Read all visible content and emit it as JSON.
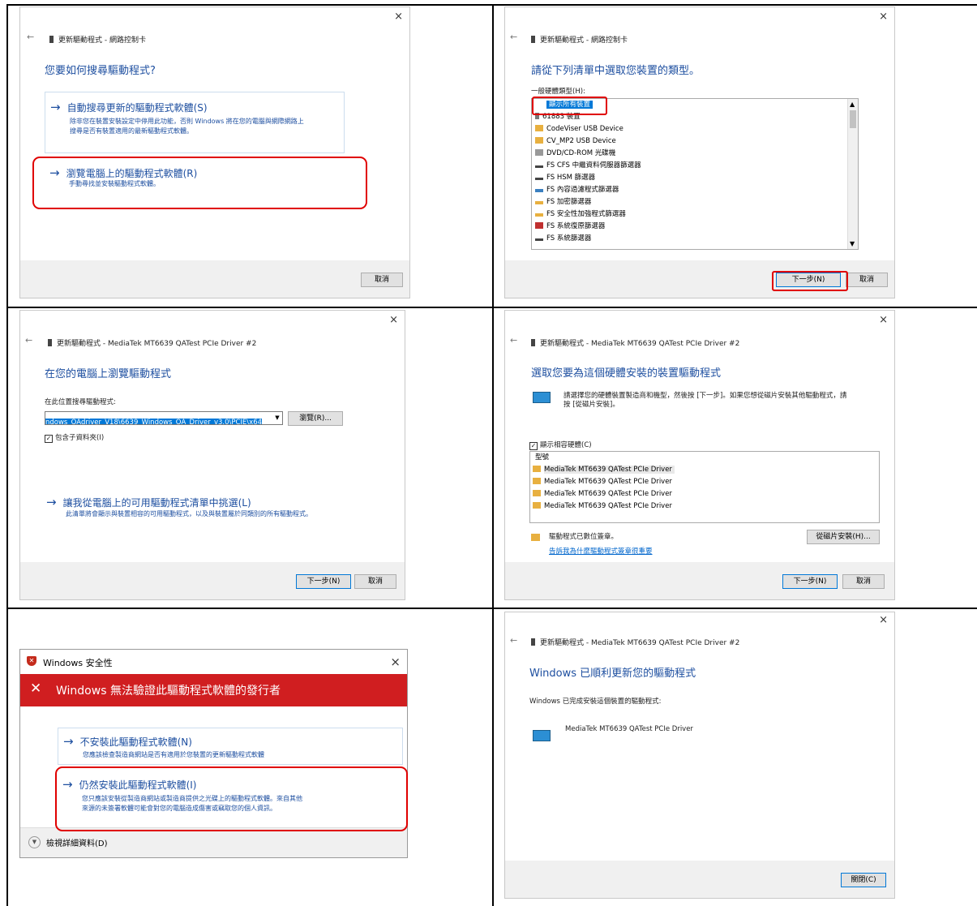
{
  "panel1": {
    "close": "×",
    "back": "←",
    "header": "更新驅動程式 - 網路控制卡",
    "heading": "您要如何搜尋驅動程式?",
    "option_auto_title": "自動搜尋更新的驅動程式軟體(S)",
    "option_auto_desc1": "除非您在裝置安裝設定中停用此功能，否則 Windows 將在您的電腦與網際網路上",
    "option_auto_desc2": "搜尋是否有裝置適用的最新驅動程式軟體。",
    "option_browse_title": "瀏覽電腦上的驅動程式軟體(R)",
    "option_browse_desc": "手動尋找並安裝驅動程式軟體。",
    "cancel": "取消"
  },
  "panel2": {
    "close": "×",
    "back": "←",
    "header": "更新驅動程式 - 網路控制卡",
    "heading": "請從下列清單中選取您裝置的類型。",
    "list_label": "一般硬體類型(H):",
    "items": [
      "顯示所有裝置",
      "61883 裝置",
      "CodeViser USB Device",
      "CV_MP2 USB Device",
      "DVD/CD-ROM 光碟機",
      "FS CFS 中繼資料伺服器篩選器",
      "FS HSM 篩選器",
      "FS 內容過濾程式篩選器",
      "FS 加密篩選器",
      "FS 安全性加強程式篩選器",
      "FS 系統復原篩選器",
      "FS 系統篩選器"
    ],
    "next": "下一步(N)",
    "cancel": "取消"
  },
  "panel3": {
    "close": "×",
    "back": "←",
    "header": "更新驅動程式 - MediaTek MT6639 QATest PCIe Driver #2",
    "heading": "在您的電腦上瀏覽驅動程式",
    "search_label": "在此位置搜尋驅動程式:",
    "path_value": "ndows_QAdriver_V18\\6639_Windows_QA_Driver_v3.0\\PCIE\\x64",
    "browse": "瀏覽(R)...",
    "include_sub": "包含子資料夾(I)",
    "pick_title": "讓我從電腦上的可用驅動程式清單中挑選(L)",
    "pick_desc": "此清單將會顯示與裝置相容的可用驅動程式，以及與裝置屬於同類別的所有驅動程式。",
    "next": "下一步(N)",
    "cancel": "取消"
  },
  "panel4": {
    "close": "×",
    "back": "←",
    "header": "更新驅動程式 - MediaTek MT6639 QATest PCIe Driver #2",
    "heading": "選取您要為這個硬體安裝的裝置驅動程式",
    "desc1": "請選擇您的硬體裝置製造商和機型，然後按 [下一步]。如果您想從磁片安裝其他驅動程式，請",
    "desc2": "按 [從磁片安裝]。",
    "show_compat": "顯示相容硬體(C)",
    "model_header": "型號",
    "models": [
      "MediaTek MT6639 QATest PCIe Driver",
      "MediaTek MT6639 QATest PCIe Driver",
      "MediaTek MT6639 QATest PCIe Driver",
      "MediaTek MT6639 QATest PCIe Driver"
    ],
    "signed": "驅動程式已數位簽章。",
    "why_link": "告訴我為什麼驅動程式簽章很重要",
    "have_disk": "從磁片安裝(H)...",
    "next": "下一步(N)",
    "cancel": "取消"
  },
  "panel5": {
    "title": "Windows 安全性",
    "close": "×",
    "banner": "Windows 無法驗證此驅動程式軟體的發行者",
    "banner_x": "✕",
    "opt1_title": "不安裝此驅動程式軟體(N)",
    "opt1_desc": "您應該檢查製造商網站是否有適用於您裝置的更新驅動程式軟體",
    "opt2_title": "仍然安裝此驅動程式軟體(I)",
    "opt2_desc1": "您只應該安裝從製造商網站或製造商提供之光碟上的驅動程式軟體。來自其他",
    "opt2_desc2": "來源的未簽署軟體可能會對您的電腦造成傷害或竊取您的個人資訊。",
    "details": "檢視詳細資料(D)"
  },
  "panel6": {
    "close": "×",
    "back": "←",
    "header": "更新驅動程式 - MediaTek MT6639 QATest PCIe Driver #2",
    "heading": "Windows 已順利更新您的驅動程式",
    "desc": "Windows 已完成安裝這個裝置的驅動程式:",
    "device": "MediaTek MT6639 QATest PCIe Driver",
    "close_btn": "關閉(C)"
  }
}
